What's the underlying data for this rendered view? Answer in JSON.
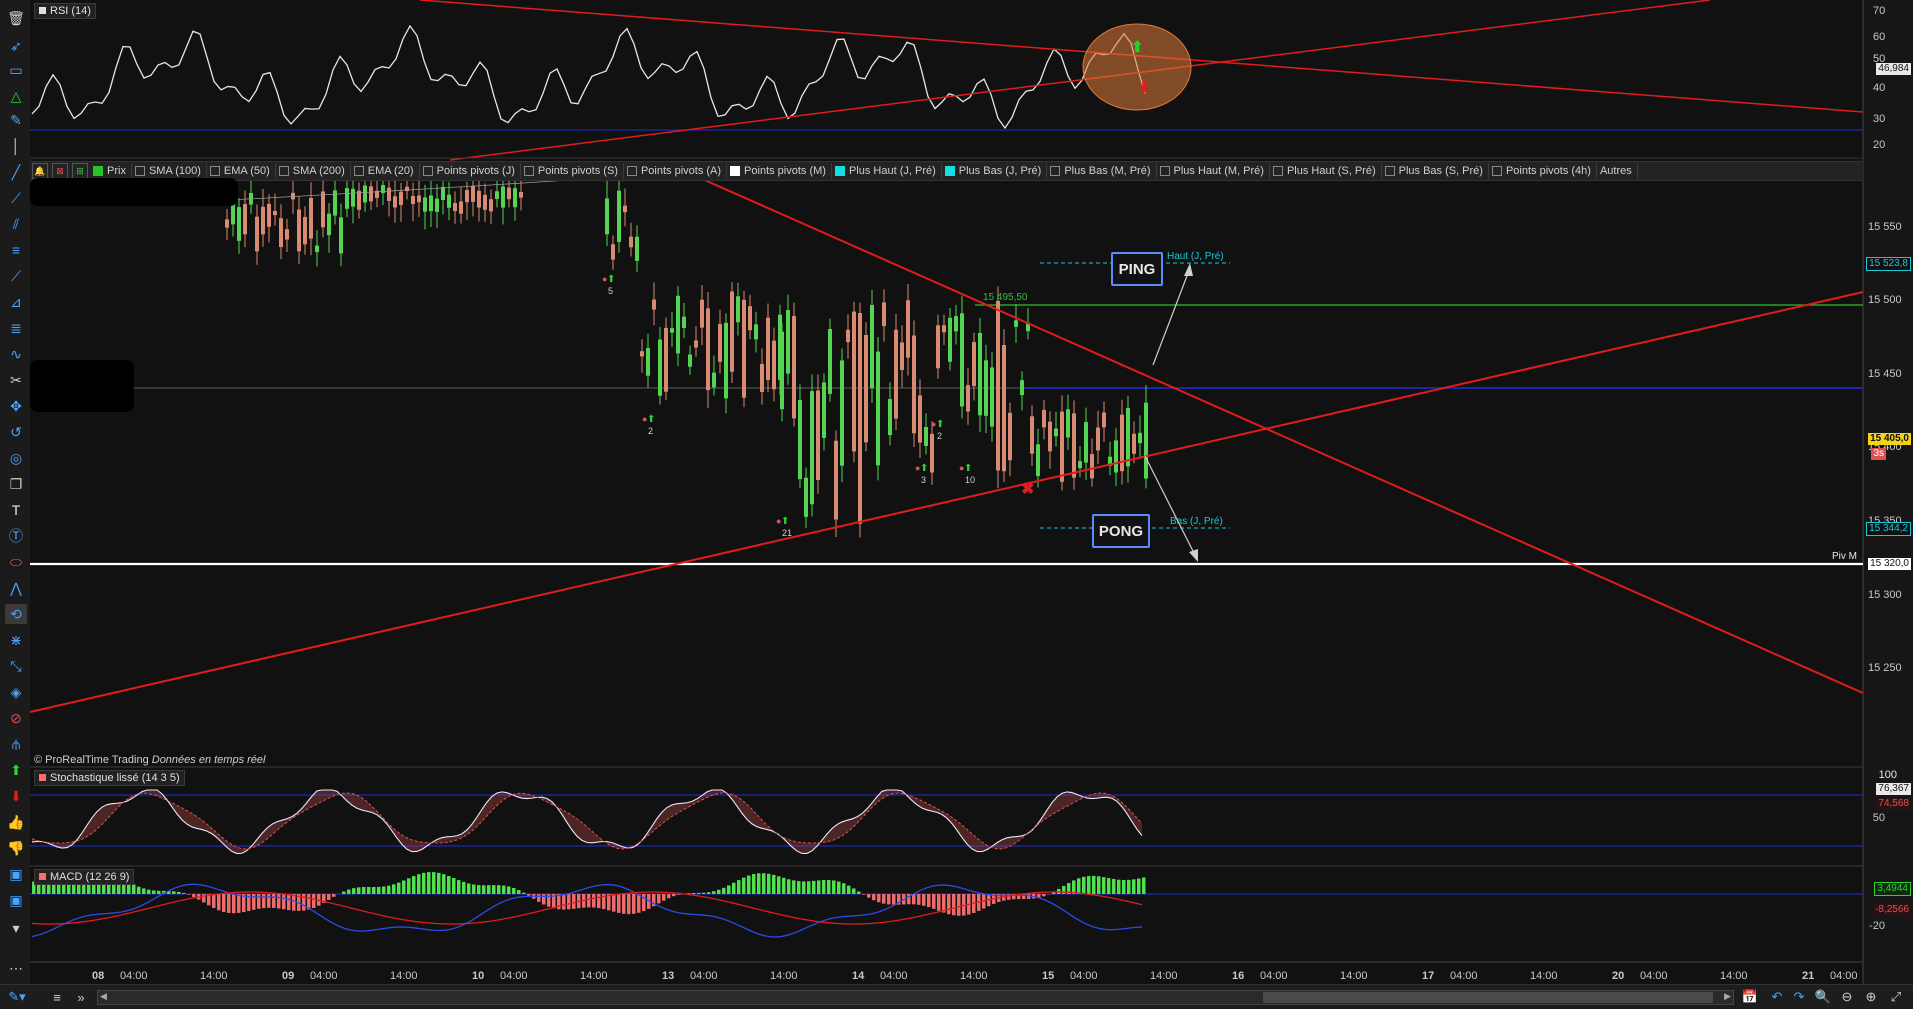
{
  "rsi": {
    "label": "RSI (14)",
    "levels": [
      "70",
      "60",
      "50",
      "40",
      "30",
      "20"
    ],
    "current_value": "46,984"
  },
  "price_panel": {
    "indicators": [
      {
        "label": "Prix",
        "state": "green"
      },
      {
        "label": "SMA (100)",
        "state": "off"
      },
      {
        "label": "EMA (50)",
        "state": "off"
      },
      {
        "label": "SMA (200)",
        "state": "off"
      },
      {
        "label": "EMA (20)",
        "state": "off"
      },
      {
        "label": "Points pivots (J)",
        "state": "off"
      },
      {
        "label": "Points pivots (S)",
        "state": "off"
      },
      {
        "label": "Points pivots (A)",
        "state": "off"
      },
      {
        "label": "Points pivots (M)",
        "state": "on"
      },
      {
        "label": "Plus Haut (J, Pré)",
        "state": "cyan"
      },
      {
        "label": "Plus Bas (J, Pré)",
        "state": "cyan"
      },
      {
        "label": "Plus Bas (M, Pré)",
        "state": "off"
      },
      {
        "label": "Plus Haut (M, Pré)",
        "state": "off"
      },
      {
        "label": "Plus Haut (S, Pré)",
        "state": "off"
      },
      {
        "label": "Plus Bas (S, Pré)",
        "state": "off"
      },
      {
        "label": "Points pivots (4h)",
        "state": "off"
      }
    ],
    "autres_label": "Autres",
    "price_levels": [
      "15 550",
      "15 500",
      "15 450",
      "15 400",
      "15 350",
      "15 300",
      "15 250"
    ],
    "price_tags": {
      "haut_j_pre": "15 523,8",
      "current": "15 405,0",
      "countdown": "3s",
      "bas_j_pre": "15 344,2",
      "piv_m": "15 320,0"
    },
    "haut_label": "Haut (J, Pré)",
    "bas_label": "Bas (J, Pré)",
    "piv_label": "Piv M",
    "green_level_label": "15 495,50",
    "ping_label": "PING",
    "pong_label": "PONG",
    "signal_counts": [
      "5",
      "2",
      "21",
      "2",
      "3",
      "10"
    ],
    "watermark": "© ProRealTime Trading",
    "watermark_italic": "Données en temps réel"
  },
  "stochastic": {
    "label": "Stochastique lissé (14 3 5)",
    "top_level": "100",
    "mid_level": "50",
    "value_1": "76,367",
    "value_2": "74,568"
  },
  "macd": {
    "label": "MACD (12 26 9)",
    "value_1": "3,4944",
    "value_2": "-8,2566",
    "level": "-20"
  },
  "time_axis": {
    "labels": [
      {
        "day": "08",
        "times": [
          "04:00",
          "14:00"
        ]
      },
      {
        "day": "09",
        "times": [
          "04:00",
          "14:00"
        ]
      },
      {
        "day": "10",
        "times": [
          "04:00",
          "14:00"
        ]
      },
      {
        "day": "13",
        "times": [
          "04:00",
          "14:00"
        ]
      },
      {
        "day": "14",
        "times": [
          "04:00",
          "14:00"
        ]
      },
      {
        "day": "15",
        "times": [
          "04:00",
          "14:00"
        ]
      },
      {
        "day": "16",
        "times": [
          "04:00",
          "14:00"
        ]
      },
      {
        "day": "17",
        "times": [
          "04:00",
          "14:00"
        ]
      },
      {
        "day": "20",
        "times": [
          "04:00",
          "14:00"
        ]
      },
      {
        "day": "21",
        "times": [
          "04:00"
        ]
      }
    ]
  },
  "colors": {
    "background": "#111111",
    "bull_candle": "#53d453",
    "bear_candle": "#d98a72",
    "trendline": "#e01c1c",
    "blue_level": "#1e2fd8",
    "green_level": "#2fbf2f",
    "cyan_level": "#18c8d8",
    "rsi_line": "#e6e6e6",
    "macd_bull": "#4fe24f",
    "macd_bear": "#f06a6a"
  }
}
